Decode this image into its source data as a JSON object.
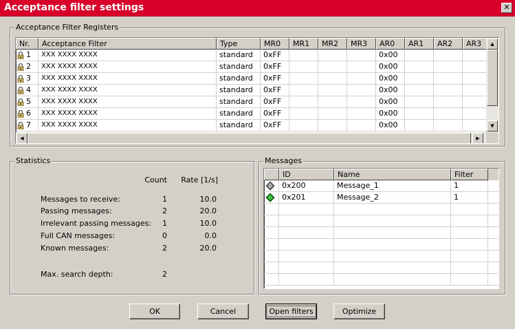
{
  "window": {
    "title": "Acceptance filter settings",
    "close_symbol": "✕"
  },
  "registers": {
    "group_label": "Acceptance Filter Registers",
    "columns": [
      "Nr.",
      "Acceptance Filter",
      "Type",
      "MR0",
      "MR1",
      "MR2",
      "MR3",
      "AR0",
      "AR1",
      "AR2",
      "AR3"
    ],
    "rows": [
      {
        "nr": "1",
        "filter": "XXX XXXX XXXX",
        "type": "standard",
        "mr0": "0xFF",
        "ar0": "0x00"
      },
      {
        "nr": "2",
        "filter": "XXX XXXX XXXX",
        "type": "standard",
        "mr0": "0xFF",
        "ar0": "0x00"
      },
      {
        "nr": "3",
        "filter": "XXX XXXX XXXX",
        "type": "standard",
        "mr0": "0xFF",
        "ar0": "0x00"
      },
      {
        "nr": "4",
        "filter": "XXX XXXX XXXX",
        "type": "standard",
        "mr0": "0xFF",
        "ar0": "0x00"
      },
      {
        "nr": "5",
        "filter": "XXX XXXX XXXX",
        "type": "standard",
        "mr0": "0xFF",
        "ar0": "0x00"
      },
      {
        "nr": "6",
        "filter": "XXX XXXX XXXX",
        "type": "standard",
        "mr0": "0xFF",
        "ar0": "0x00"
      },
      {
        "nr": "7",
        "filter": "XXX XXXX XXXX",
        "type": "standard",
        "mr0": "0xFF",
        "ar0": "0x00"
      }
    ],
    "row_icon": "lock-icon"
  },
  "statistics": {
    "group_label": "Statistics",
    "count_header": "Count",
    "rate_header": "Rate [1/s]",
    "items": [
      {
        "label": "Messages to receive:",
        "count": "1",
        "rate": "10.0"
      },
      {
        "label": "Passing messages:",
        "count": "2",
        "rate": "20.0"
      },
      {
        "label": "Irrelevant passing messages:",
        "count": "1",
        "rate": "10.0"
      },
      {
        "label": "Full CAN messages:",
        "count": "0",
        "rate": "0.0"
      },
      {
        "label": "Known messages:",
        "count": "2",
        "rate": "20.0"
      }
    ],
    "search_depth_label": "Max. search depth:",
    "search_depth_value": "2"
  },
  "messages": {
    "group_label": "Messages",
    "columns": [
      "",
      "ID",
      "Name",
      "Filter"
    ],
    "rows": [
      {
        "icon": "gray-diamond-icon",
        "icon_color": "#808080",
        "id": "0x200",
        "name": "Message_1",
        "filter": "1"
      },
      {
        "icon": "green-diamond-icon",
        "icon_color": "#00a000",
        "id": "0x201",
        "name": "Message_2",
        "filter": "1"
      }
    ]
  },
  "buttons": {
    "ok": "OK",
    "cancel": "Cancel",
    "open_filters": "Open filters",
    "optimize": "Optimize"
  },
  "colors": {
    "title_bar": "#d8002a",
    "dialog_bg": "#d4d0c8"
  }
}
